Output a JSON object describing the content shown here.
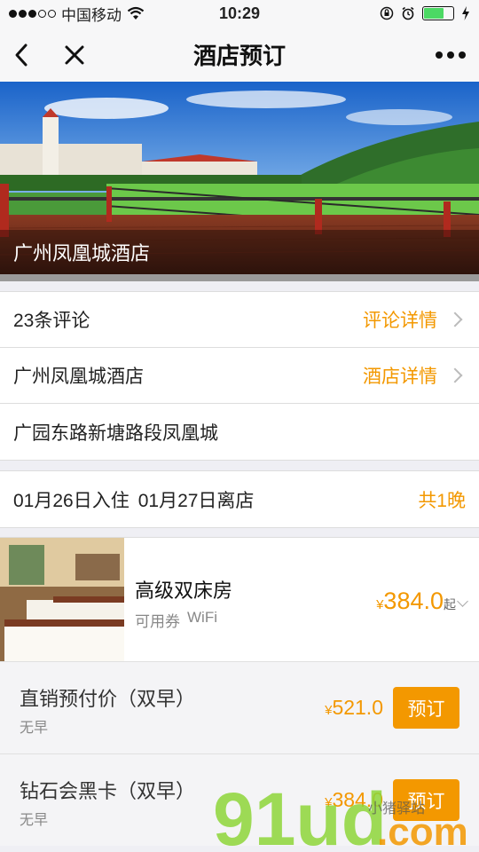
{
  "status_bar": {
    "carrier": "中国移动",
    "time": "10:29",
    "signal_icon": "signal-dots-icon",
    "wifi_icon": "wifi-icon",
    "battery_level": 0.7
  },
  "nav": {
    "title": "酒店预订",
    "back_icon": "back-chevron-icon",
    "close_icon": "close-icon",
    "more_icon": "more-icon"
  },
  "hero": {
    "caption": "广州凤凰城酒店"
  },
  "info": {
    "reviews_count_label": "23条评论",
    "reviews_link": "评论详情",
    "hotel_name": "广州凤凰城酒店",
    "hotel_link": "酒店详情",
    "address": "广园东路新塘路段凤凰城"
  },
  "stay": {
    "checkin": "01月26日入住",
    "checkout": "01月27日离店",
    "nights": "共1晚"
  },
  "room": {
    "name": "高级双床房",
    "tags": [
      "可用券",
      "WiFi"
    ],
    "currency": "¥",
    "price": "384.0",
    "price_suffix": "起"
  },
  "plans": [
    {
      "name": "直销预付价（双早）",
      "breakfast": "无早",
      "currency": "¥",
      "price": "521.0",
      "button": "预订"
    },
    {
      "name": "钻石会黑卡（双早）",
      "breakfast": "无早",
      "currency": "¥",
      "price": "384.0",
      "button": "预订"
    }
  ],
  "watermark": {
    "text": "91ud.com",
    "small_text": "小猪驿站"
  },
  "colors": {
    "accent": "#f39800",
    "background": "#efeff4",
    "nav_bg": "#f7f7f8"
  }
}
